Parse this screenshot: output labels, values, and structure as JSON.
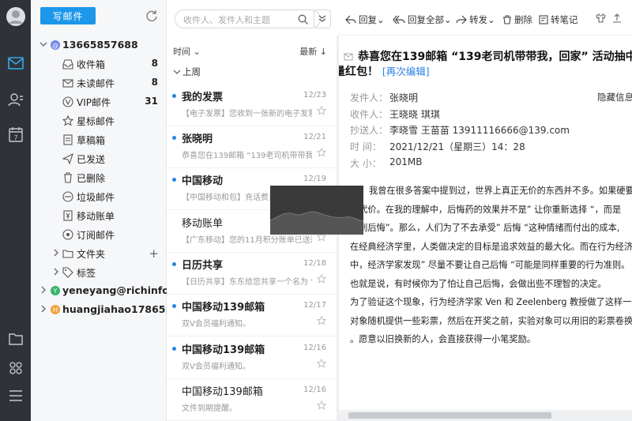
{
  "nav": {
    "icons": [
      "avatar-icon",
      "mail-icon",
      "contacts-icon",
      "calendar-icon",
      "files-icon",
      "apps-icon",
      "menu-icon"
    ]
  },
  "folders": {
    "compose_label": "写邮件",
    "account_primary": "13665857688",
    "items": [
      {
        "label": "收件箱",
        "count": "8",
        "icon": "inbox-icon"
      },
      {
        "label": "未读邮件",
        "count": "8",
        "icon": "unread-icon"
      },
      {
        "label": "VIP邮件",
        "count": "31",
        "icon": "vip-icon"
      },
      {
        "label": "星标邮件",
        "count": "",
        "icon": "star-icon"
      },
      {
        "label": "草稿箱",
        "count": "",
        "icon": "draft-icon"
      },
      {
        "label": "已发送",
        "count": "",
        "icon": "sent-icon"
      },
      {
        "label": "已删除",
        "count": "",
        "icon": "trash-icon"
      },
      {
        "label": "垃圾邮件",
        "count": "",
        "icon": "spam-icon"
      },
      {
        "label": "移动账单",
        "count": "",
        "icon": "bill-icon"
      },
      {
        "label": "订阅邮件",
        "count": "",
        "icon": "subscribe-icon"
      },
      {
        "label": "文件夹",
        "count": "",
        "icon": "folder-icon"
      },
      {
        "label": "标签",
        "count": "",
        "icon": "tag-icon"
      }
    ],
    "accounts": [
      {
        "label": "yeneyang@richinfo...",
        "badge": "Y",
        "color": "#3bb36b"
      },
      {
        "label": "huangjiahao17865...",
        "badge": "H",
        "color": "#f2a23a"
      }
    ]
  },
  "list": {
    "search_placeholder": "收件人、发件人和主题",
    "sort_left": "时间",
    "sort_right": "最新",
    "group": "上周",
    "messages": [
      {
        "sender": "我的发票",
        "date": "12/23",
        "preview": "【电子发票】您收到一张新的电子发票。",
        "unread": true
      },
      {
        "sender": "张晓明",
        "date": "12/21",
        "preview": "恭喜您在139邮箱 “139老司机带带我",
        "unread": true
      },
      {
        "sender": "中国移动",
        "date": "12/19",
        "preview": "【中国移动和包】充话费日",
        "unread": true
      },
      {
        "sender": "移动账单",
        "date": "12/19",
        "preview": "【广东移动】您的11月积分账单已送达",
        "unread": false
      },
      {
        "sender": "日历共享",
        "date": "12/18",
        "preview": "【日历共享】东东给您共享一个名为 “活...",
        "unread": true
      },
      {
        "sender": "中国移动139邮箱",
        "date": "12/17",
        "preview": "双V会员福利通知。",
        "unread": true
      },
      {
        "sender": "中国移动139邮箱",
        "date": "12/16",
        "preview": "双V会员福利通知。",
        "unread": true
      },
      {
        "sender": "中国移动139邮箱",
        "date": "12/16",
        "preview": "文件到期提醒。",
        "unread": false
      }
    ]
  },
  "reader": {
    "toolbar": [
      "回复",
      "回复全部",
      "转发",
      "删除",
      "转笔记"
    ],
    "subject_line1": "恭喜您在139邮箱 “139老司机带带我，回家” 活动抽中500M",
    "subject_line2": "流量红包！",
    "edit_link": "[再次编辑]",
    "hide_label": "隐藏信息",
    "headers": [
      {
        "k": "发件人：",
        "v": "张晓明"
      },
      {
        "k": "收件人：",
        "v": "王晓晓     琪琪"
      },
      {
        "k": "抄送人：",
        "v": "李晓雪     王苗苗     13911116666@139.com"
      },
      {
        "k": "时  间：",
        "v": "2021/12/21（星期三）14：28"
      },
      {
        "k": "大  小：",
        "v": "201MB"
      }
    ],
    "body": [
      "我曾在很多答案中提到过，世界上真正无价的东西并不多。如果硬要",
      "的代价。在我的理解中，后悔药的效果并不是” 让你重新选择 “，而是",
      "要到后悔”。那么，人们为了不去承受” 后悔 “这种情绪而付出的成本,",
      "在经典经济学里，人类做决定的目标是追求效益的最大化。而在行为经济学",
      "中，经济学家发现” 尽量不要让自己后悔 “可能是同样重要的行为准则。",
      "也就是说，有时候你为了怕让自己后悔，会做出些不理智的决定。",
      "为了验证这个现象，行为经济学家 Ven 和 Zeelenberg 教授做了这样一组",
      "对象随机提供一些彩票，然后在开奖之前，实验对象可以用旧的彩票卷换取",
      "。愿意以旧换新的人，会直接获得一小笔奖励。"
    ]
  }
}
